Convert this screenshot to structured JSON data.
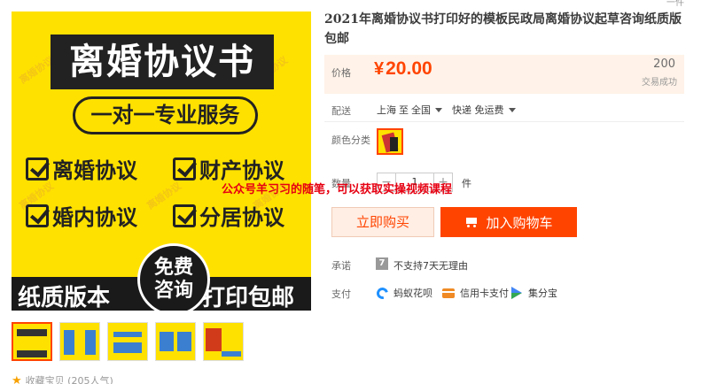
{
  "top_mark": "一件",
  "product": {
    "title": "2021年离婚协议书打印好的模板民政局离婚协议起草咨询纸质版包邮"
  },
  "main_image": {
    "headline": "离婚协议书",
    "service": "一对一专业服务",
    "features": [
      "离婚协议",
      "财产协议",
      "婚内协议",
      "分居协议"
    ],
    "bottom_left": "纸质版本",
    "bottom_right": "打印包邮",
    "circle_line1": "免费",
    "circle_line2": "咨询",
    "watermark": "离婚协议"
  },
  "favorite": {
    "label": "收藏宝贝 (205人气)"
  },
  "price": {
    "label": "价格",
    "currency": "¥",
    "value": "20.00",
    "sales_count": "200",
    "sales_label": "交易成功"
  },
  "shipping": {
    "label": "配送",
    "from": "上海",
    "to_word": "至",
    "destination": "全国",
    "method": "快递 免运费"
  },
  "color": {
    "label": "颜色分类"
  },
  "quantity": {
    "label": "数量",
    "value": "1",
    "minus": "−",
    "plus": "+",
    "unit": "件"
  },
  "overlay_text": "公众号羊习习的随笔，可以获取实操视频课程",
  "buttons": {
    "buy_now": "立即购买",
    "add_to_cart": "加入购物车"
  },
  "promise": {
    "label": "承诺",
    "icon_glyph": "7",
    "text": "不支持7天无理由"
  },
  "payment": {
    "label": "支付",
    "methods": [
      "蚂蚁花呗",
      "信用卡支付",
      "集分宝"
    ]
  },
  "colors": {
    "accent": "#ff4400",
    "price_bg": "#fff2e8",
    "poster_yellow": "#ffe100"
  }
}
